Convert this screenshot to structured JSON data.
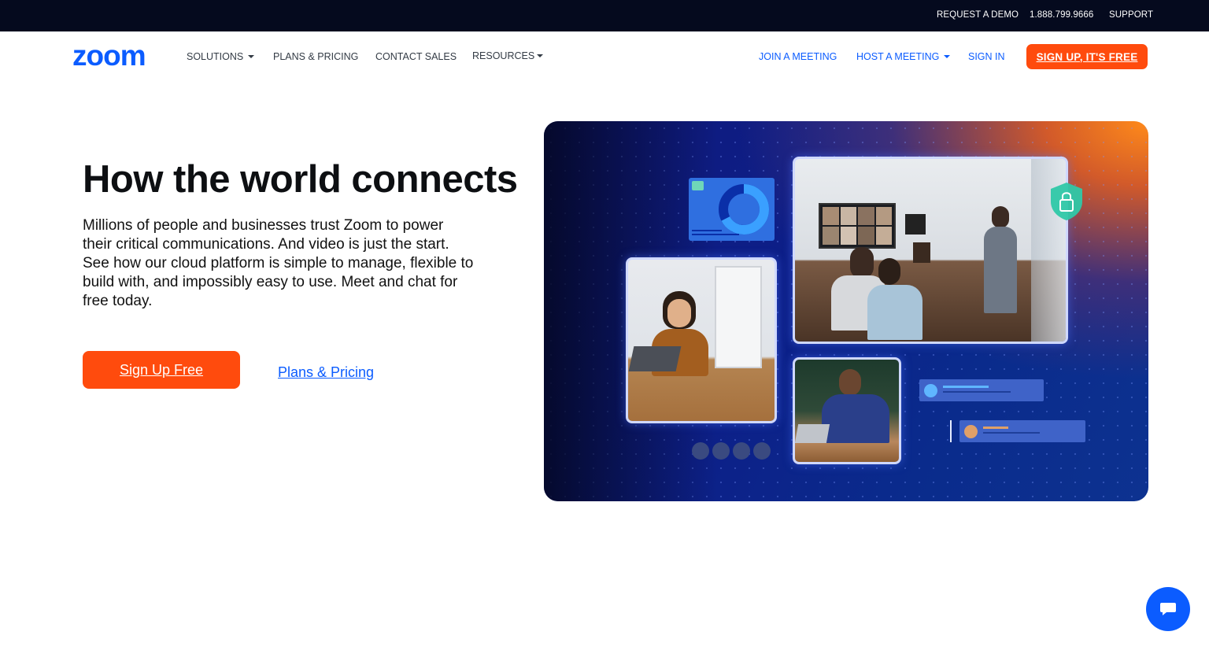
{
  "topbar": {
    "request_demo": "REQUEST A DEMO",
    "phone": "1.888.799.9666",
    "support": "SUPPORT"
  },
  "nav": {
    "logo_text": "zoom",
    "solutions": "SOLUTIONS",
    "plans_pricing": "PLANS & PRICING",
    "contact_sales": "CONTACT SALES",
    "resources": "RESOURCES",
    "join_meeting": "JOIN A MEETING",
    "host_meeting": "HOST A MEETING",
    "sign_in": "SIGN IN",
    "signup_cta": "SIGN UP, IT'S FREE"
  },
  "hero": {
    "title": "How the world connects",
    "description": "Millions of people and businesses trust Zoom to power their critical communications. And video is just the start. See how our cloud platform is simple to manage, flexible to build with, and impossibly easy to use. Meet and chat for free today.",
    "signup_button": "Sign Up Free",
    "pricing_link": "Plans & Pricing"
  },
  "colors": {
    "brand_blue": "#0b5cff",
    "cta_orange": "#ff4b0d",
    "topbar_bg": "#050a1e"
  },
  "icons": [
    "caret-down-icon",
    "lock-shield-icon",
    "chat-bubble-icon",
    "video-icon",
    "phone-icon",
    "chat-icon",
    "contacts-icon",
    "upload-icon"
  ]
}
